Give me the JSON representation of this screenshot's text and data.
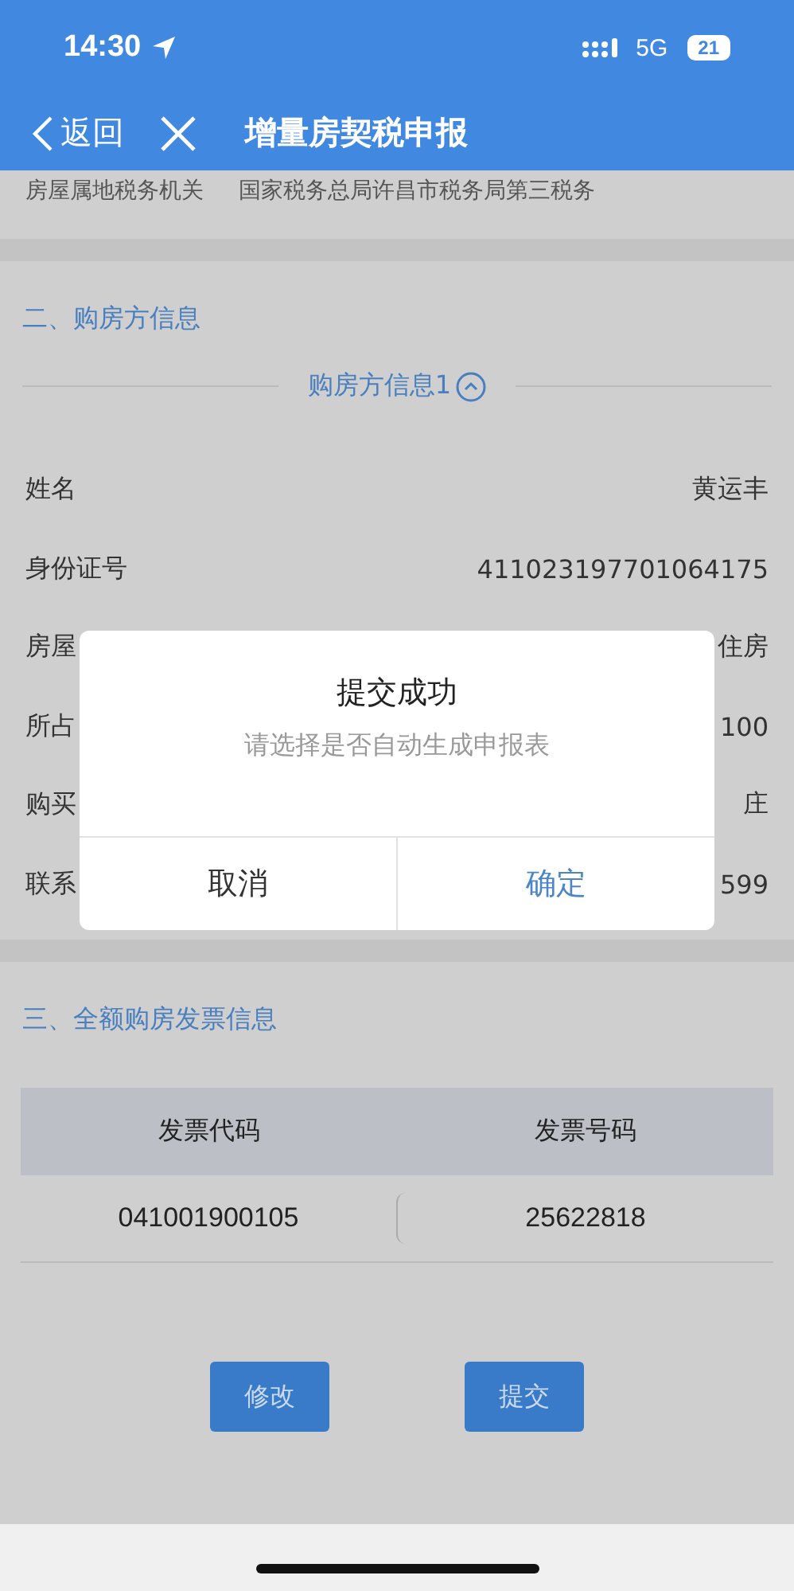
{
  "status_bar": {
    "time": "14:30",
    "network": "5G",
    "battery": "21"
  },
  "nav": {
    "back_label": "返回",
    "title": "增量房契税申报"
  },
  "partial_row": {
    "label": "房屋属地税务机关",
    "value": "国家税务总局许昌市税务局第三税务"
  },
  "buyer_section": {
    "title": "二、购房方信息",
    "group_label": "购房方信息1",
    "expanded": true,
    "rows": [
      {
        "label": "姓名",
        "value": "黄运丰"
      },
      {
        "label": "身份证号",
        "value": "411023197701064175"
      },
      {
        "label": "房屋",
        "value": "住房"
      },
      {
        "label": "所占",
        "value": "100"
      },
      {
        "label": "购买",
        "value": "庄"
      },
      {
        "label": "联系",
        "value": "599"
      }
    ]
  },
  "invoice_section": {
    "title": "三、全额购房发票信息",
    "columns": [
      "发票代码",
      "发票号码"
    ],
    "rows": [
      [
        "041001900105",
        "25622818"
      ]
    ]
  },
  "buttons": [
    "修改",
    "提交"
  ],
  "dialog": {
    "title": "提交成功",
    "message": "请选择是否自动生成申报表",
    "buttons": [
      {
        "label": "取消",
        "kind": "cancel"
      },
      {
        "label": "确定",
        "kind": "confirm"
      }
    ]
  }
}
